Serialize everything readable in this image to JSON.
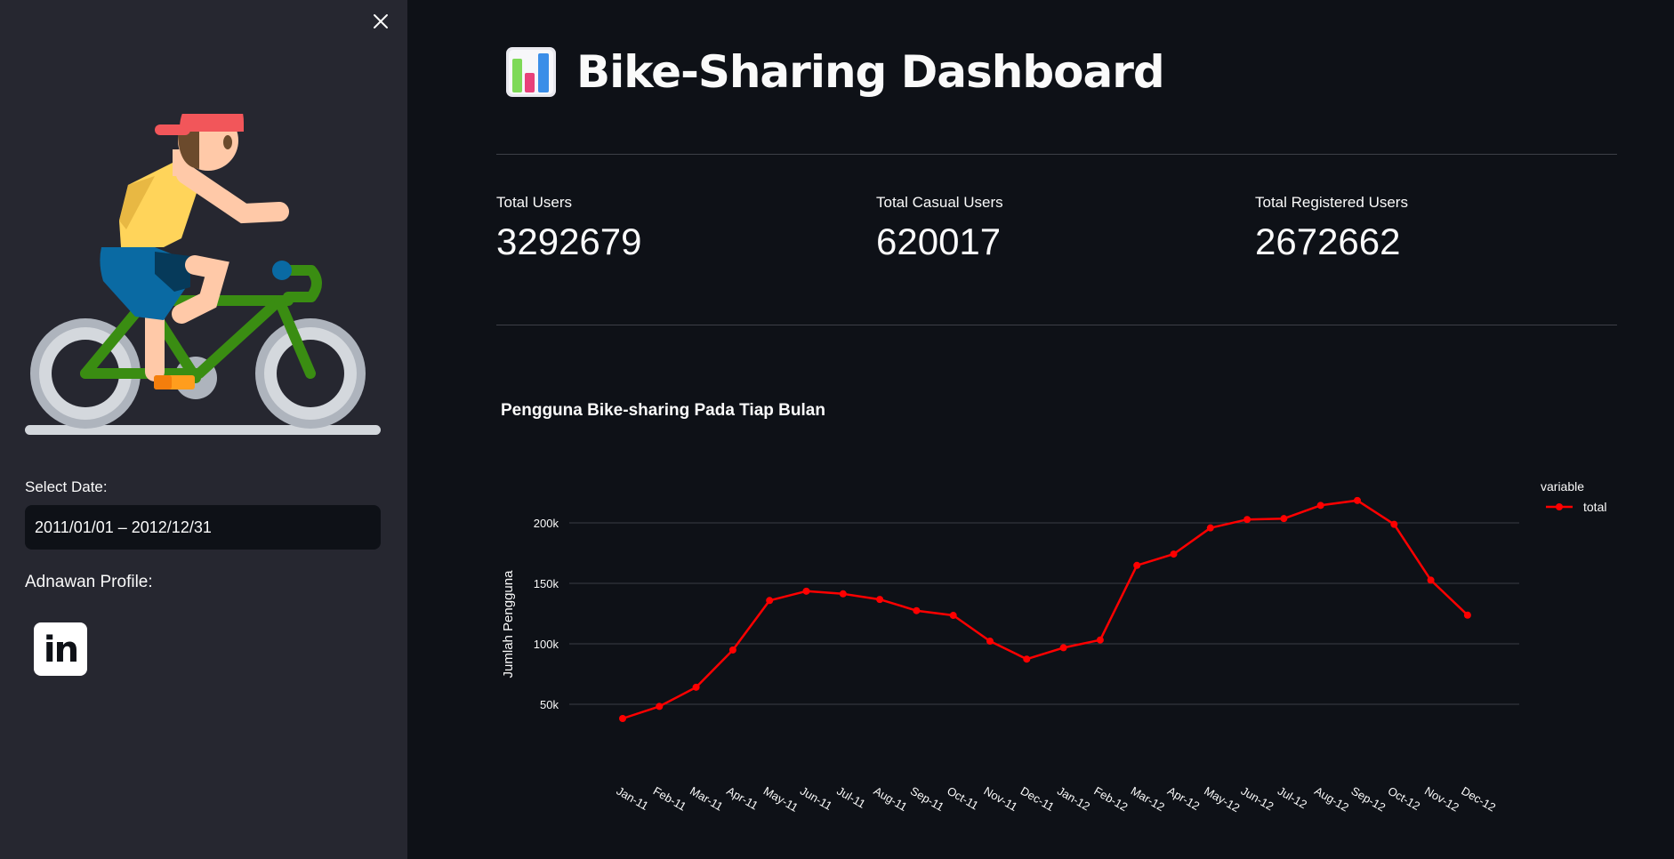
{
  "sidebar": {
    "close_icon": "close-icon",
    "illustration": "cyclist-illustration",
    "date_label": "Select Date:",
    "date_value": "2011/01/01 – 2012/12/31",
    "profile_label": "Adnawan Profile:",
    "profile_link_icon": "linkedin-icon",
    "profile_link_text": "in"
  },
  "header": {
    "icon": "bar-chart-icon",
    "title": "Bike-Sharing Dashboard"
  },
  "metrics": [
    {
      "label": "Total Users",
      "value": "3292679"
    },
    {
      "label": "Total Casual Users",
      "value": "620017"
    },
    {
      "label": "Total Registered Users",
      "value": "2672662"
    }
  ],
  "colors": {
    "background": "#0e1117",
    "sidebar": "#262730",
    "series": "#ff0000",
    "text": "#fafafa"
  },
  "chart_data": {
    "type": "line",
    "title": "Pengguna Bike-sharing Pada Tiap Bulan",
    "xlabel": "",
    "ylabel": "Jumlah Pengguna",
    "legend_title": "variable",
    "legend_position": "top-right",
    "grid": true,
    "ylim": [
      22000,
      228000
    ],
    "yticks": [
      50000,
      100000,
      150000,
      200000
    ],
    "ytick_labels": [
      "50k",
      "100k",
      "150k",
      "200k"
    ],
    "categories": [
      "Jan-11",
      "Feb-11",
      "Mar-11",
      "Apr-11",
      "May-11",
      "Jun-11",
      "Jul-11",
      "Aug-11",
      "Sep-11",
      "Oct-11",
      "Nov-11",
      "Dec-11",
      "Jan-12",
      "Feb-12",
      "Mar-12",
      "Apr-12",
      "May-12",
      "Jun-12",
      "Jul-12",
      "Aug-12",
      "Sep-12",
      "Oct-12",
      "Nov-12",
      "Dec-12"
    ],
    "series": [
      {
        "name": "total",
        "values": [
          38189,
          48215,
          64045,
          94870,
          135821,
          143512,
          141341,
          136691,
          127418,
          123511,
          102167,
          87323,
          96744,
          103137,
          164875,
          174224,
          195865,
          202830,
          203607,
          214503,
          218573,
          198841,
          152664,
          123713
        ]
      }
    ]
  }
}
